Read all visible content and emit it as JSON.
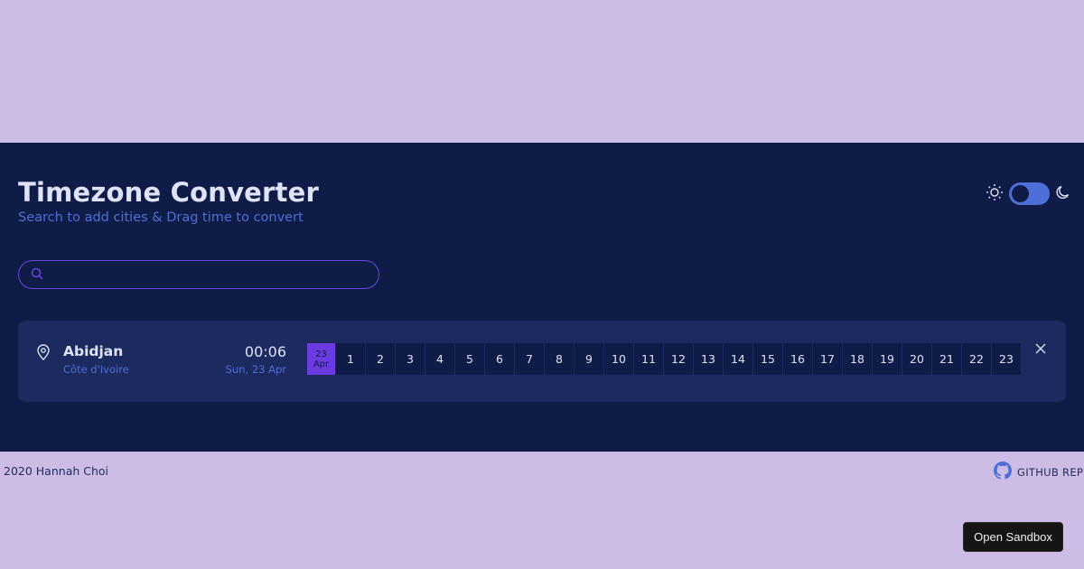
{
  "header": {
    "title": "Timezone Converter",
    "subtitle": "Search to add cities & Drag time to convert"
  },
  "theme": {
    "light_icon": "sun-icon",
    "dark_icon": "moon-icon",
    "mode": "light"
  },
  "search": {
    "placeholder": "",
    "value": "",
    "icon": "search-icon"
  },
  "cities": [
    {
      "name": "Abidjan",
      "country": "Côte d'Ivoire",
      "time": "00:06",
      "date": "Sun, 23 Apr",
      "current_day": "23",
      "current_month": "Apr",
      "hours": [
        "1",
        "2",
        "3",
        "4",
        "5",
        "6",
        "7",
        "8",
        "9",
        "10",
        "11",
        "12",
        "13",
        "14",
        "15",
        "16",
        "17",
        "18",
        "19",
        "20",
        "21",
        "22",
        "23"
      ]
    }
  ],
  "footer": {
    "copyright": "2020 Hannah Choi",
    "repo_label": "GITHUB REP"
  },
  "sandbox_button": "Open Sandbox",
  "colors": {
    "page_bg": "#cdbde6",
    "app_bg": "#0f1c47",
    "card_bg": "#1c2a60",
    "accent": "#4f6fd8",
    "highlight": "#6c3be0"
  }
}
